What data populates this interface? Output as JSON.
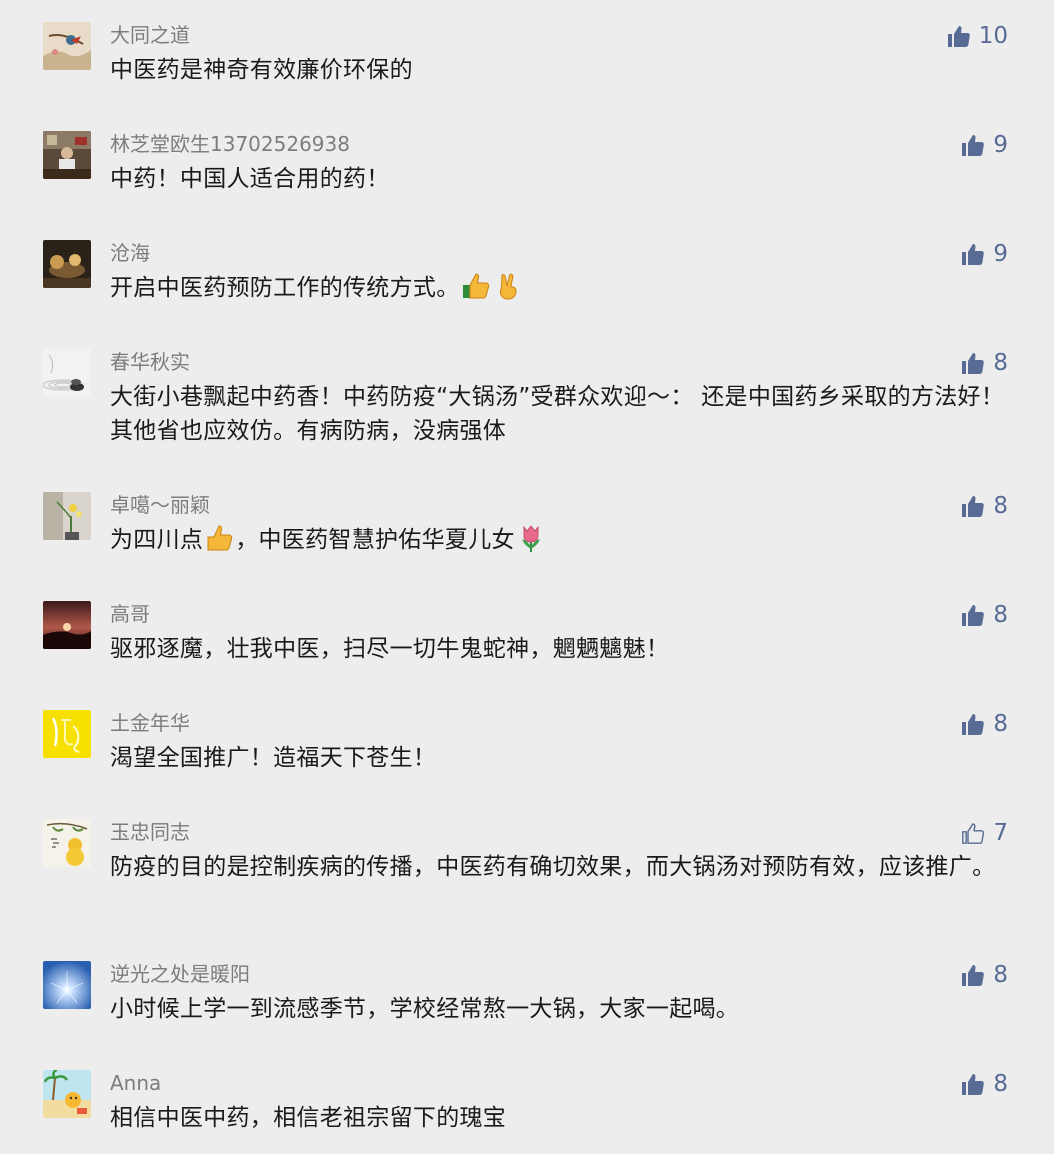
{
  "comments": [
    {
      "username": "大同之道",
      "content": "中医药是神奇有效廉价环保的",
      "likes": "10",
      "liked": true,
      "avatar": "bird-painting"
    },
    {
      "username": "林芝堂欧生13702526938",
      "content": "中药！中国人适合用的药！",
      "likes": "9",
      "liked": true,
      "avatar": "office-photo"
    },
    {
      "username": "沧海",
      "content": "开启中医药预防工作的传统方式。",
      "likes": "9",
      "liked": true,
      "avatar": "tea-photo",
      "emoji_after": [
        "thumbs-up-emoji",
        "victory-hand-emoji"
      ]
    },
    {
      "username": "春华秋实",
      "content": "大街小巷飘起中药香！中药防疫“大锅汤”受群众欢迎～： 还是中国药乡采取的方法好！其他省也应效仿。有病防病，没病强体",
      "likes": "8",
      "liked": true,
      "avatar": "zen-stones"
    },
    {
      "username": "卓噶～丽颖",
      "content_before": "为四川点",
      "content_middle": "，中医药智慧护佑华夏儿女",
      "likes": "8",
      "liked": true,
      "avatar": "flower-vase"
    },
    {
      "username": "高哥",
      "content": "驱邪逐魔，壮我中医，扫尽一切牛鬼蛇神，魍魉魑魅！",
      "likes": "8",
      "liked": true,
      "avatar": "sunset-photo"
    },
    {
      "username": "土金年华",
      "content": "渴望全国推广！造福天下苍生！",
      "likes": "8",
      "liked": true,
      "avatar": "yellow-calligraphy"
    },
    {
      "username": "玉忠同志",
      "content": "防疫的目的是控制疾病的传播，中医药有确切效果，而大锅汤对预防有效，应该推广。",
      "likes": "7",
      "liked": false,
      "avatar": "gourd-painting"
    },
    {
      "username": "逆光之处是暖阳",
      "content": "小时候上学一到流感季节，学校经常熬一大锅，大家一起喝。",
      "likes": "8",
      "liked": true,
      "avatar": "sun-sky"
    },
    {
      "username": "Anna",
      "content": "相信中医中药，相信老祖宗留下的瑰宝",
      "likes": "8",
      "liked": true,
      "avatar": "beach-cartoon"
    }
  ],
  "colors": {
    "background": "#ededed",
    "username": "#7d7d7d",
    "text": "#1a1a1a",
    "like_accent": "#576b95"
  }
}
